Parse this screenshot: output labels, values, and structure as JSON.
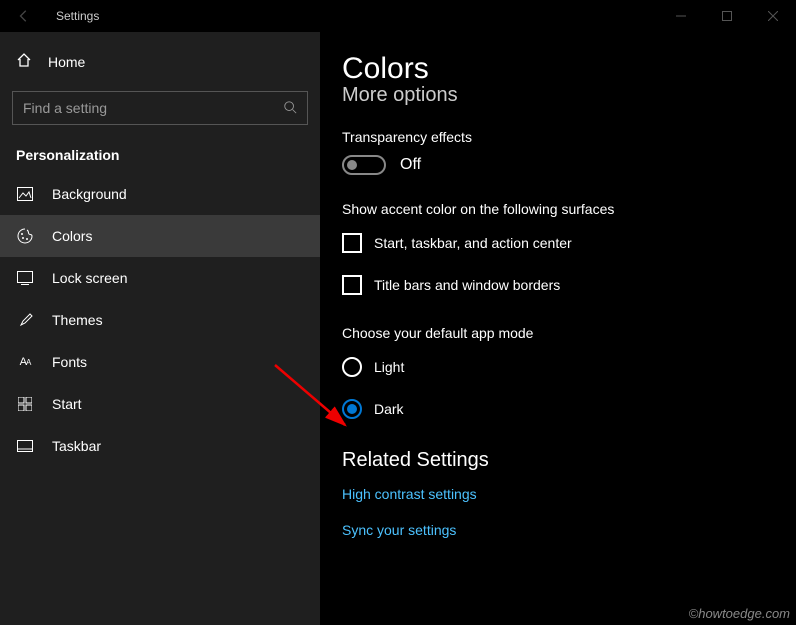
{
  "titlebar": {
    "title": "Settings"
  },
  "sidebar": {
    "home_label": "Home",
    "search_placeholder": "Find a setting",
    "section_title": "Personalization",
    "items": [
      {
        "label": "Background"
      },
      {
        "label": "Colors"
      },
      {
        "label": "Lock screen"
      },
      {
        "label": "Themes"
      },
      {
        "label": "Fonts"
      },
      {
        "label": "Start"
      },
      {
        "label": "Taskbar"
      }
    ]
  },
  "content": {
    "page_title": "Colors",
    "subheading": "More options",
    "transparency_label": "Transparency effects",
    "transparency_state": "Off",
    "accent_label": "Show accent color on the following surfaces",
    "checkbox1": "Start, taskbar, and action center",
    "checkbox2": "Title bars and window borders",
    "app_mode_label": "Choose your default app mode",
    "radio_light": "Light",
    "radio_dark": "Dark",
    "related_title": "Related Settings",
    "link1": "High contrast settings",
    "link2": "Sync your settings"
  },
  "watermark": "©howtoedge.com"
}
